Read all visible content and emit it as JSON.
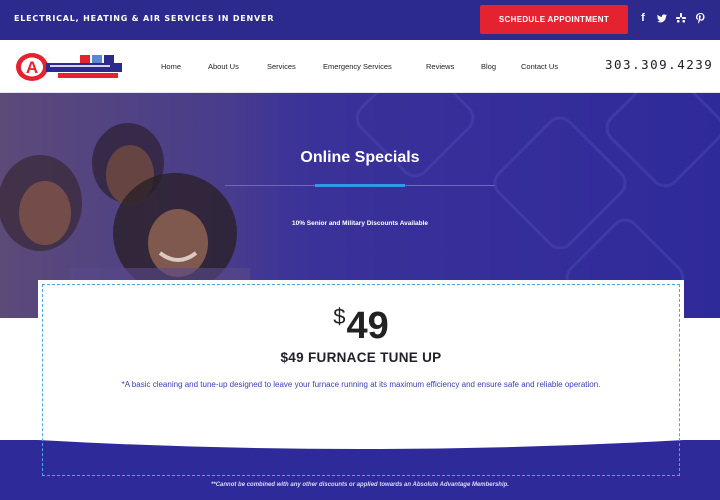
{
  "topbar": {
    "tagline": "ELECTRICAL, HEATING & AIR SERVICES IN DENVER",
    "cta_label": "SCHEDULE APPOINTMENT",
    "social": [
      {
        "icon": "facebook-icon",
        "glyph": "f"
      },
      {
        "icon": "twitter-icon",
        "glyph": "t"
      },
      {
        "icon": "yelp-icon",
        "glyph": "✱"
      },
      {
        "icon": "pinterest-icon",
        "glyph": "p"
      }
    ],
    "bg_color": "#2d2a8e",
    "cta_color": "#e52330"
  },
  "nav": {
    "links": [
      "Home",
      "About Us",
      "Services",
      "Emergency Services",
      "Reviews",
      "Blog",
      "Contact Us"
    ],
    "phone": "303.309.4239"
  },
  "hero": {
    "title": "Online Specials",
    "subtitle": "10% Senior and Military Discounts Available",
    "accent_color": "#2f9be8"
  },
  "offer": {
    "currency": "$",
    "amount": "49",
    "title": "$49 FURNACE TUNE UP",
    "description": "*A basic cleaning and tune-up designed to leave your furnace running at its maximum efficiency and ensure safe and reliable operation."
  },
  "footer": {
    "disclaimer": "**Cannot be combined with any other discounts or applied towards an Absolute Advantage Membership."
  }
}
